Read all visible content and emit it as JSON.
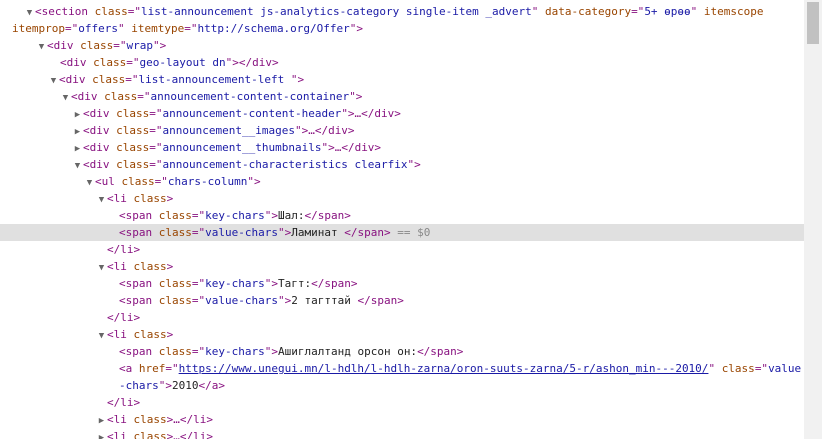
{
  "rows": [
    [
      [
        "t",
        "▼"
      ],
      [
        "p",
        "<section "
      ],
      [
        "n",
        "class"
      ],
      [
        "p",
        "=\""
      ],
      [
        "v",
        "list-announcement js-analytics-category single-item _advert"
      ],
      [
        "p",
        "\" "
      ],
      [
        "n",
        "data-category"
      ],
      [
        "p",
        "=\""
      ],
      [
        "v",
        "5+ өрөө"
      ],
      [
        "p",
        "\" "
      ],
      [
        "n",
        "itemscope"
      ]
    ],
    [
      [
        "n",
        "itemprop"
      ],
      [
        "p",
        "=\""
      ],
      [
        "v",
        "offers"
      ],
      [
        "p",
        "\" "
      ],
      [
        "n",
        "itemtype"
      ],
      [
        "p",
        "=\""
      ],
      [
        "v",
        "http://schema.org/Offer"
      ],
      [
        "p",
        "\">"
      ]
    ],
    [
      [
        "t",
        "▼"
      ],
      [
        "p",
        "<div "
      ],
      [
        "n",
        "class"
      ],
      [
        "p",
        "=\""
      ],
      [
        "v",
        "wrap"
      ],
      [
        "p",
        "\">"
      ]
    ],
    [
      [
        "p",
        "<div "
      ],
      [
        "n",
        "class"
      ],
      [
        "p",
        "=\""
      ],
      [
        "v",
        "geo-layout dn"
      ],
      [
        "p",
        "\"></div>"
      ]
    ],
    [
      [
        "t",
        "▼"
      ],
      [
        "p",
        "<div "
      ],
      [
        "n",
        "class"
      ],
      [
        "p",
        "=\""
      ],
      [
        "v",
        "list-announcement-left "
      ],
      [
        "p",
        "\">"
      ]
    ],
    [
      [
        "t",
        "▼"
      ],
      [
        "p",
        "<div "
      ],
      [
        "n",
        "class"
      ],
      [
        "p",
        "=\""
      ],
      [
        "v",
        "announcement-content-container"
      ],
      [
        "p",
        "\">"
      ]
    ],
    [
      [
        "t",
        "▶"
      ],
      [
        "p",
        "<div "
      ],
      [
        "n",
        "class"
      ],
      [
        "p",
        "=\""
      ],
      [
        "v",
        "announcement-content-header"
      ],
      [
        "p",
        "\">…</div>"
      ]
    ],
    [
      [
        "t",
        "▶"
      ],
      [
        "p",
        "<div "
      ],
      [
        "n",
        "class"
      ],
      [
        "p",
        "=\""
      ],
      [
        "v",
        "announcement__images"
      ],
      [
        "p",
        "\">…</div>"
      ]
    ],
    [
      [
        "t",
        "▶"
      ],
      [
        "p",
        "<div "
      ],
      [
        "n",
        "class"
      ],
      [
        "p",
        "=\""
      ],
      [
        "v",
        "announcement__thumbnails"
      ],
      [
        "p",
        "\">…</div>"
      ]
    ],
    [
      [
        "t",
        "▼"
      ],
      [
        "p",
        "<div "
      ],
      [
        "n",
        "class"
      ],
      [
        "p",
        "=\""
      ],
      [
        "v",
        "announcement-characteristics clearfix"
      ],
      [
        "p",
        "\">"
      ]
    ],
    [
      [
        "t",
        "▼"
      ],
      [
        "p",
        "<ul "
      ],
      [
        "n",
        "class"
      ],
      [
        "p",
        "=\""
      ],
      [
        "v",
        "chars-column"
      ],
      [
        "p",
        "\">"
      ]
    ],
    [
      [
        "t",
        "▼"
      ],
      [
        "p",
        "<li "
      ],
      [
        "n",
        "class"
      ],
      [
        "p",
        ">"
      ]
    ],
    [
      [
        "p",
        "<span "
      ],
      [
        "n",
        "class"
      ],
      [
        "p",
        "=\""
      ],
      [
        "v",
        "key-chars"
      ],
      [
        "p",
        "\">"
      ],
      [
        "x",
        "Шал:"
      ],
      [
        "p",
        "</span>"
      ]
    ],
    [
      [
        "p",
        "<span "
      ],
      [
        "n",
        "class"
      ],
      [
        "p",
        "=\""
      ],
      [
        "v",
        "value-chars"
      ],
      [
        "p",
        "\">"
      ],
      [
        "x",
        "Ламинат "
      ],
      [
        "p",
        "</span>"
      ],
      [
        "e",
        " == $0"
      ]
    ],
    [
      [
        "p",
        "</li>"
      ]
    ],
    [
      [
        "t",
        "▼"
      ],
      [
        "p",
        "<li "
      ],
      [
        "n",
        "class"
      ],
      [
        "p",
        ">"
      ]
    ],
    [
      [
        "p",
        "<span "
      ],
      [
        "n",
        "class"
      ],
      [
        "p",
        "=\""
      ],
      [
        "v",
        "key-chars"
      ],
      [
        "p",
        "\">"
      ],
      [
        "x",
        "Тагт:"
      ],
      [
        "p",
        "</span>"
      ]
    ],
    [
      [
        "p",
        "<span "
      ],
      [
        "n",
        "class"
      ],
      [
        "p",
        "=\""
      ],
      [
        "v",
        "value-chars"
      ],
      [
        "p",
        "\">"
      ],
      [
        "x",
        "2 тагттай "
      ],
      [
        "p",
        "</span>"
      ]
    ],
    [
      [
        "p",
        "</li>"
      ]
    ],
    [
      [
        "t",
        "▼"
      ],
      [
        "p",
        "<li "
      ],
      [
        "n",
        "class"
      ],
      [
        "p",
        ">"
      ]
    ],
    [
      [
        "p",
        "<span "
      ],
      [
        "n",
        "class"
      ],
      [
        "p",
        "=\""
      ],
      [
        "v",
        "key-chars"
      ],
      [
        "p",
        "\">"
      ],
      [
        "x",
        "Ашиглалтанд орсон он:"
      ],
      [
        "p",
        "</span>"
      ]
    ],
    [
      [
        "p",
        "<a "
      ],
      [
        "n",
        "href"
      ],
      [
        "p",
        "=\""
      ],
      [
        "l",
        "https://www.unegui.mn/l-hdlh/l-hdlh-zarna/oron-suuts-zarna/5-r/ashon_min---2010/"
      ],
      [
        "p",
        "\" "
      ],
      [
        "n",
        "class"
      ],
      [
        "p",
        "=\""
      ],
      [
        "v",
        "value"
      ]
    ],
    [
      [
        "v",
        "-chars"
      ],
      [
        "p",
        "\">"
      ],
      [
        "x",
        "2010"
      ],
      [
        "p",
        "</a>"
      ]
    ],
    [
      [
        "p",
        "</li>"
      ]
    ],
    [
      [
        "t",
        "▶"
      ],
      [
        "p",
        "<li "
      ],
      [
        "n",
        "class"
      ],
      [
        "p",
        ">…</li>"
      ]
    ],
    [
      [
        "t",
        "▶"
      ],
      [
        "p",
        "<li "
      ],
      [
        "n",
        "class"
      ],
      [
        "p",
        ">…</li>"
      ]
    ]
  ]
}
